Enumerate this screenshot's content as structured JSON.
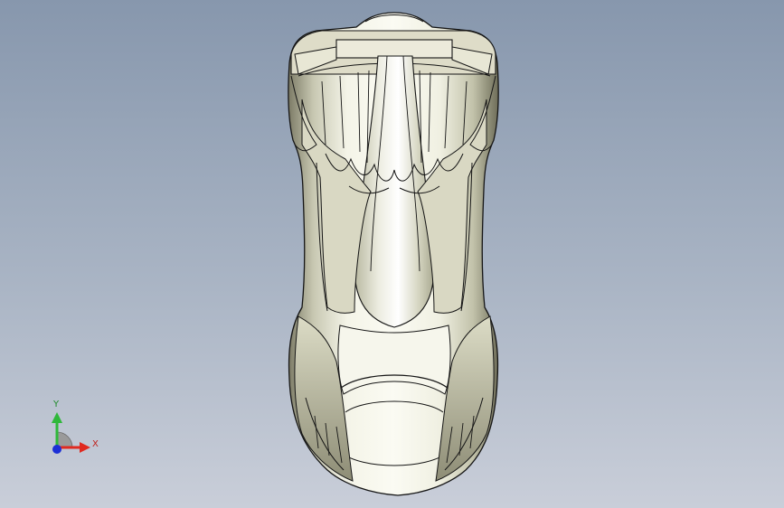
{
  "triad": {
    "x_label": "X",
    "y_label": "Y",
    "colors": {
      "x": "#e02a20",
      "y": "#2fb83a",
      "z": "#1c2fd6"
    }
  },
  "model": {
    "body_color": "#e4e4d0",
    "edge_color": "#151515"
  },
  "background": {
    "top": "#8797ad",
    "bottom": "#c9ced9"
  }
}
